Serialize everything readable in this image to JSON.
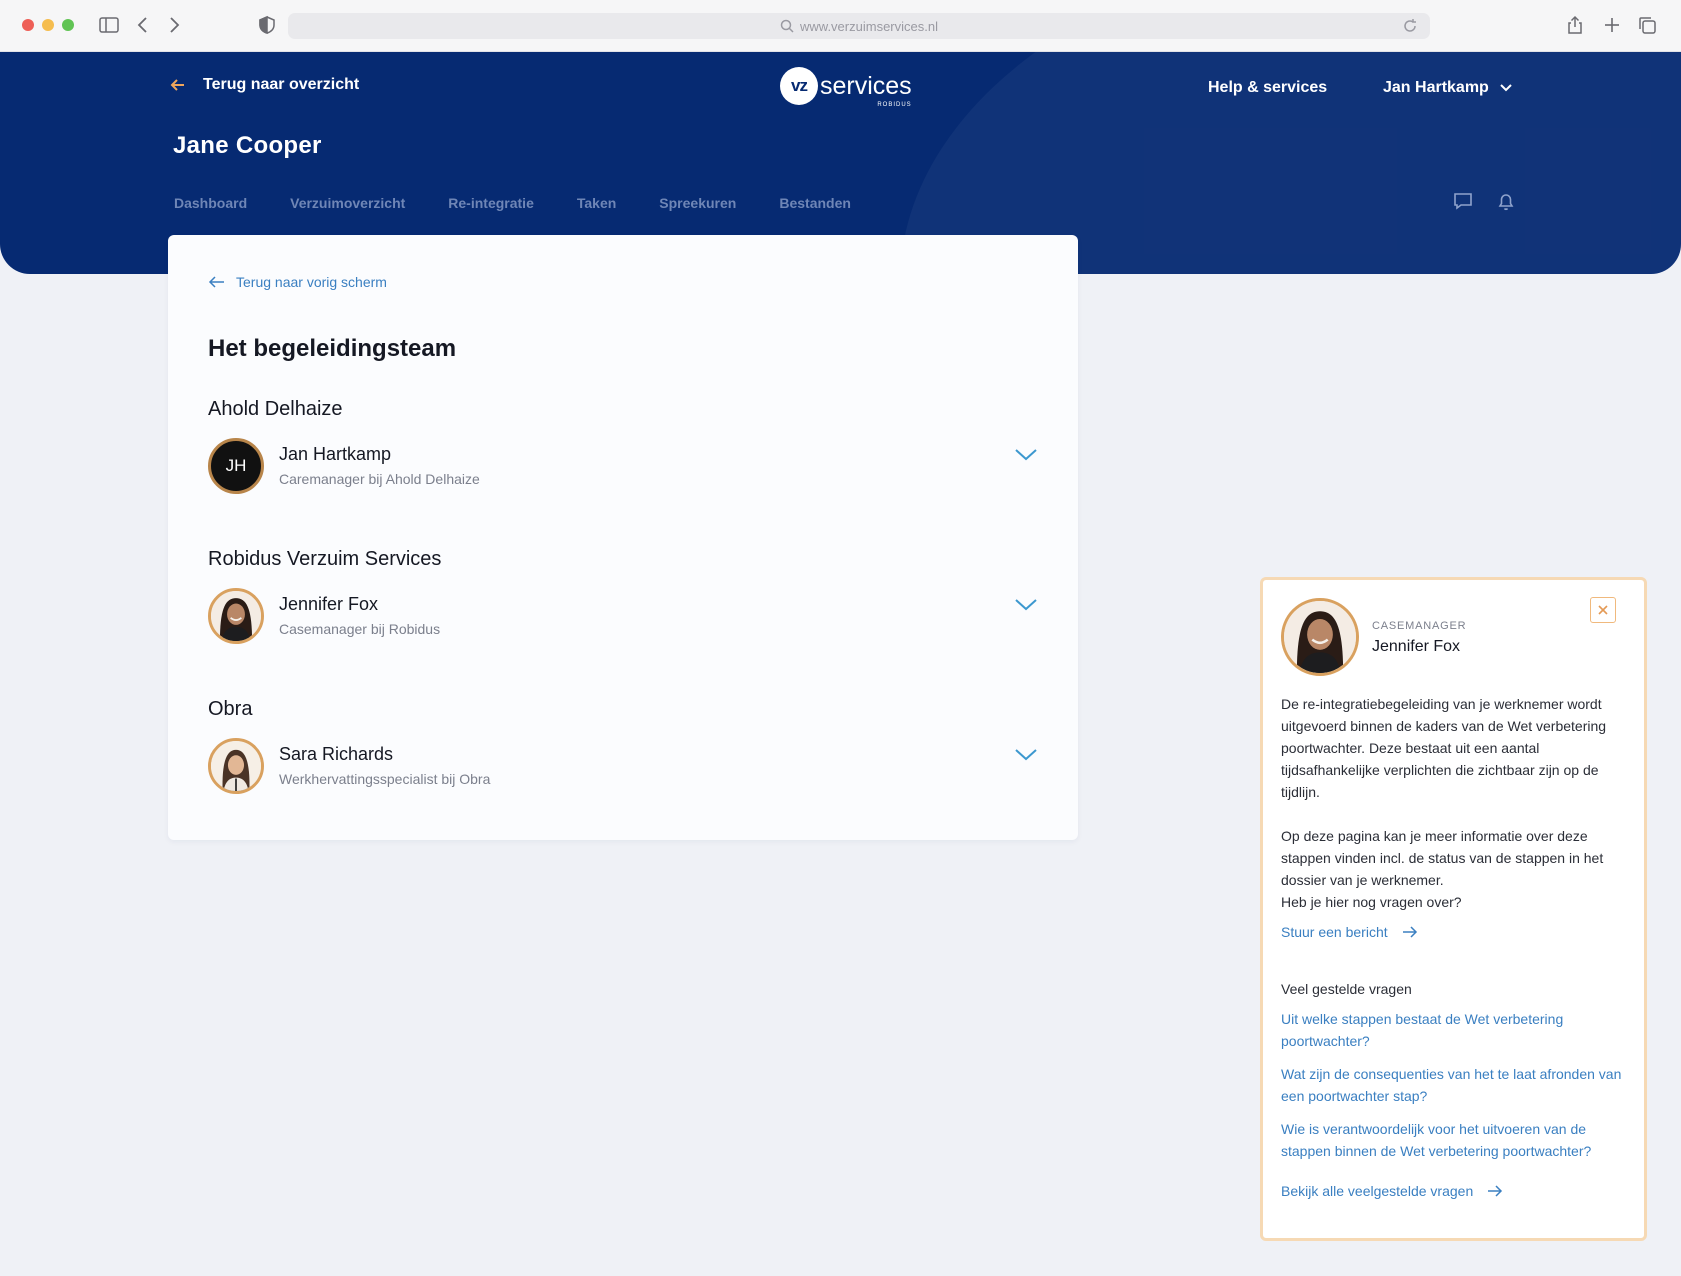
{
  "browser": {
    "url": "www.verzuimservices.nl"
  },
  "header": {
    "back_label": "Terug naar overzicht",
    "logo_badge": "vz",
    "logo_word": "services",
    "logo_sub": "ROBIDUS",
    "help_label": "Help & services",
    "user_label": "Jan Hartkamp",
    "person_title": "Jane Cooper",
    "tabs": [
      {
        "label": "Dashboard"
      },
      {
        "label": "Verzuimoverzicht"
      },
      {
        "label": "Re-integratie"
      },
      {
        "label": "Taken"
      },
      {
        "label": "Spreekuren"
      },
      {
        "label": "Bestanden"
      }
    ],
    "icons": [
      "chat-icon",
      "bell-icon"
    ]
  },
  "card": {
    "prev_label": "Terug naar vorig scherm",
    "title": "Het begeleidingsteam",
    "groups": [
      {
        "title": "Ahold Delhaize",
        "member": {
          "initials": "JH",
          "name": "Jan Hartkamp",
          "role": "Caremanager bij Ahold Delhaize"
        }
      },
      {
        "title": "Robidus Verzuim Services",
        "member": {
          "name": "Jennifer Fox",
          "role": "Casemanager bij Robidus"
        }
      },
      {
        "title": "Obra",
        "member": {
          "name": "Sara Richards",
          "role": "Werkhervattingsspecialist bij Obra"
        }
      }
    ]
  },
  "panel": {
    "eyebrow": "CASEMANAGER",
    "name": "Jennifer Fox",
    "paragraph1": "De re-integratiebegeleiding van je werknemer wordt uitgevoerd binnen de kaders van de Wet verbetering poortwachter. Deze bestaat uit een aantal tijdsafhankelijke verplichten die zichtbaar zijn op de tijdlijn.",
    "paragraph2": "Op deze pagina kan je meer informatie over deze stappen vinden incl. de status van de stappen in het dossier van je werknemer.",
    "question": "Heb je hier nog vragen over?",
    "message_link": "Stuur een bericht",
    "faq_title": "Veel gestelde vragen",
    "faqs": [
      {
        "label": "Uit welke stappen bestaat de Wet verbetering poortwachter?"
      },
      {
        "label": "Wat zijn de consequenties van het te laat afronden van een poortwachter stap?"
      },
      {
        "label": "Wie is verantwoordelijk voor het uitvoeren van de stappen binnen de Wet verbetering poortwachter?"
      }
    ],
    "all_faq_link": "Bekijk alle veelgestelde vragen"
  },
  "colors": {
    "brand_navy": "#062a72",
    "link_blue": "#3a7fc1",
    "accent_orange": "#e49a55",
    "page_bg": "#eff1f6"
  }
}
